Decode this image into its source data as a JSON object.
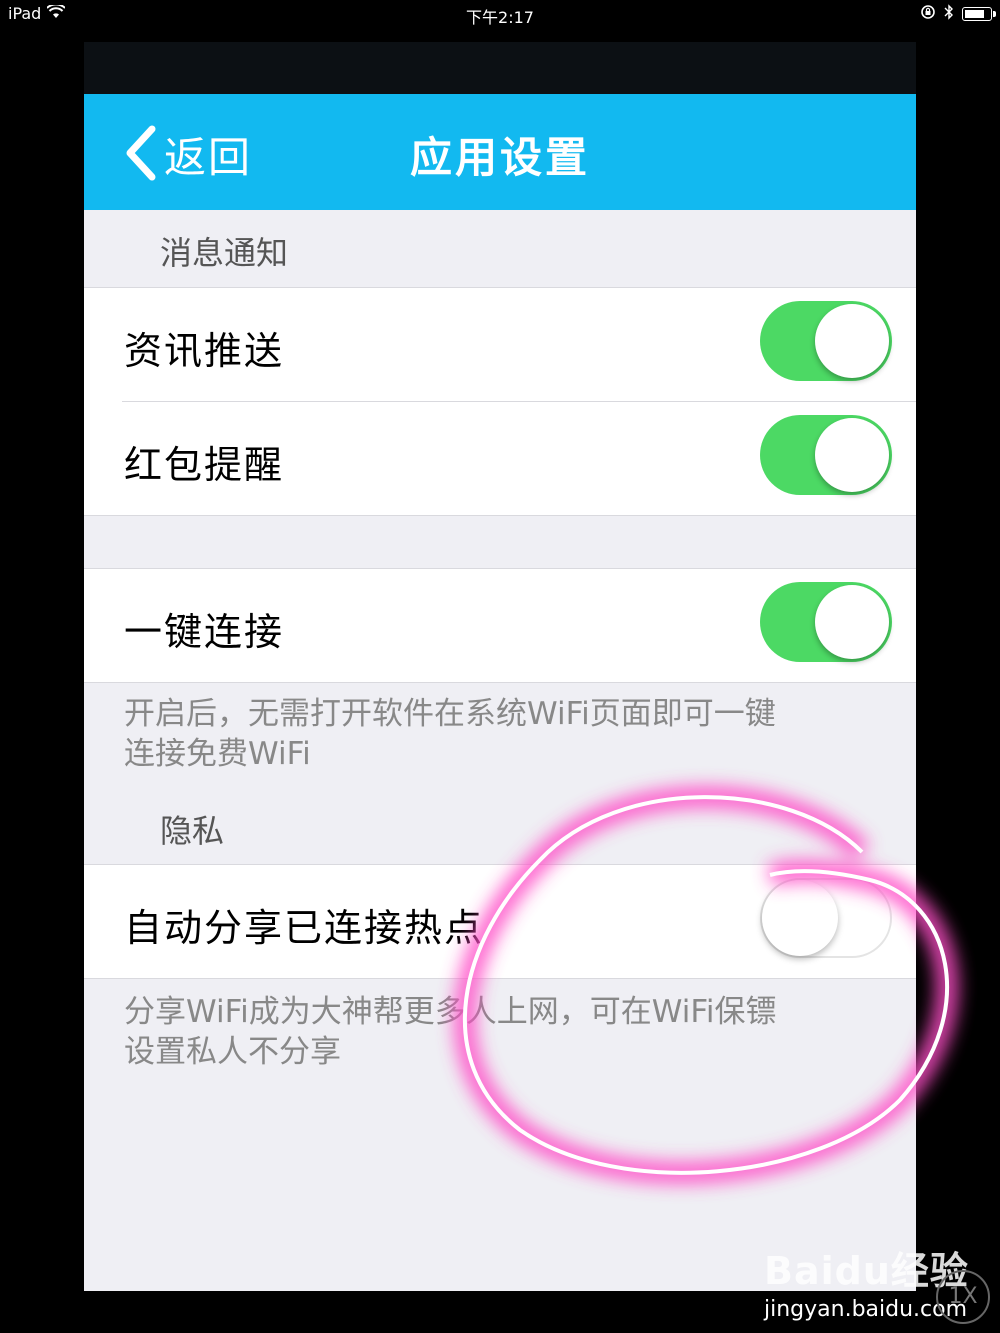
{
  "status_bar": {
    "device": "iPad",
    "time": "下午2:17",
    "icons": [
      "wifi-icon",
      "rotation-lock-icon",
      "bluetooth-icon",
      "battery-icon"
    ],
    "battery_level": 0.85
  },
  "navbar": {
    "back_label": "返回",
    "title": "应用设置",
    "color": "#12b9f0"
  },
  "sections": {
    "notifications_header": "消息通知",
    "privacy_header": "隐私"
  },
  "settings": {
    "news_push": {
      "label": "资讯推送",
      "enabled": true
    },
    "red_packet": {
      "label": "红包提醒",
      "enabled": true
    },
    "one_key_connect": {
      "label": "一键连接",
      "enabled": true
    },
    "auto_share": {
      "label": "自动分享已连接热点",
      "enabled": false
    }
  },
  "footnotes": {
    "one_key_line1": "开启后，无需打开软件在系统WiFi页面即可一键",
    "one_key_line2": "连接免费WiFi",
    "share_line1": "分享WiFi成为大神帮更多人上网，可在WiFi保镖",
    "share_line2": "设置私人不分享"
  },
  "colors": {
    "switch_on": "#4cd964",
    "annotation": "#ff4fc8"
  },
  "watermark": {
    "logo": "Baidu经验",
    "url": "jingyan.baidu.com",
    "zoom": "1X"
  }
}
